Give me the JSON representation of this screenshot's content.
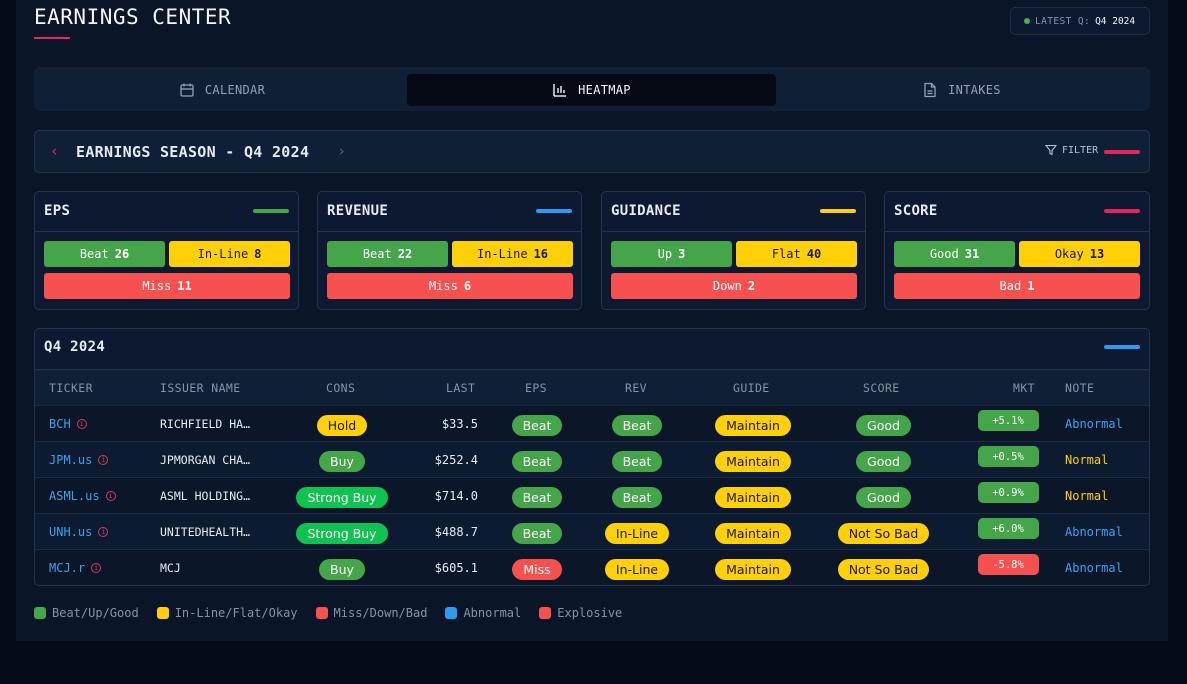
{
  "app": {
    "title": "EARNINGS CENTER",
    "latest_label": "LATEST Q:",
    "latest_value": "Q4 2024"
  },
  "tabs": [
    {
      "label": "CALENDAR",
      "icon": "calendar-icon",
      "active": false
    },
    {
      "label": "HEATMAP",
      "icon": "bar-chart-icon",
      "active": true
    },
    {
      "label": "INTAKES",
      "icon": "document-icon",
      "active": false
    }
  ],
  "season": {
    "title": "EARNINGS SEASON - Q4 2024",
    "prev": "‹",
    "next": "›",
    "filter_label": "FILTER"
  },
  "cards": [
    {
      "title": "EPS",
      "accent": "#44a549",
      "chips": [
        {
          "label": "Beat",
          "value": "26",
          "color": "g"
        },
        {
          "label": "In-Line",
          "value": "8",
          "color": "y"
        },
        {
          "label": "Miss",
          "value": "11",
          "color": "r"
        }
      ]
    },
    {
      "title": "REVENUE",
      "accent": "#2d9bf0",
      "chips": [
        {
          "label": "Beat",
          "value": "22",
          "color": "g"
        },
        {
          "label": "In-Line",
          "value": "16",
          "color": "y"
        },
        {
          "label": "Miss",
          "value": "6",
          "color": "r"
        }
      ]
    },
    {
      "title": "GUIDANCE",
      "accent": "#ffcf07",
      "chips": [
        {
          "label": "Up",
          "value": "3",
          "color": "g"
        },
        {
          "label": "Flat",
          "value": "40",
          "color": "y"
        },
        {
          "label": "Down",
          "value": "2",
          "color": "r"
        }
      ]
    },
    {
      "title": "SCORE",
      "accent": "#e3245d",
      "chips": [
        {
          "label": "Good",
          "value": "31",
          "color": "g"
        },
        {
          "label": "Okay",
          "value": "13",
          "color": "y"
        },
        {
          "label": "Bad",
          "value": "1",
          "color": "r"
        }
      ]
    }
  ],
  "table": {
    "title": "Q4 2024",
    "columns": [
      "TICKER",
      "ISSUER NAME",
      "CONS",
      "LAST",
      "EPS",
      "REV",
      "GUIDE",
      "SCORE",
      "MKT",
      "NOTE"
    ],
    "rows": [
      {
        "ticker": "BCH",
        "issuer": "RICHFIELD HA…",
        "cons": "Hold",
        "cons_color": "y",
        "last": "$33.5",
        "eps": "Beat",
        "eps_color": "g",
        "rev": "Beat",
        "rev_color": "g",
        "guide": "Maintain",
        "guide_color": "y",
        "score": "Good",
        "score_color": "g",
        "mkt": "+5.1%",
        "mkt_color": "g",
        "note": "Abnormal",
        "note_color": "#3b9ff0"
      },
      {
        "ticker": "JPM.us",
        "issuer": "JPMORGAN CHA…",
        "cons": "Buy",
        "cons_color": "g",
        "last": "$252.4",
        "eps": "Beat",
        "eps_color": "g",
        "rev": "Beat",
        "rev_color": "g",
        "guide": "Maintain",
        "guide_color": "y",
        "score": "Good",
        "score_color": "g",
        "mkt": "+0.5%",
        "mkt_color": "g",
        "note": "Normal",
        "note_color": "#ffcf07"
      },
      {
        "ticker": "ASML.us",
        "issuer": "ASML HOLDING…",
        "cons": "Strong Buy",
        "cons_color": "sg",
        "last": "$714.0",
        "eps": "Beat",
        "eps_color": "g",
        "rev": "Beat",
        "rev_color": "g",
        "guide": "Maintain",
        "guide_color": "y",
        "score": "Good",
        "score_color": "g",
        "mkt": "+0.9%",
        "mkt_color": "g",
        "note": "Normal",
        "note_color": "#ffcf07"
      },
      {
        "ticker": "UNH.us",
        "issuer": "UNITEDHEALTH…",
        "cons": "Strong Buy",
        "cons_color": "sg",
        "last": "$488.7",
        "eps": "Beat",
        "eps_color": "g",
        "rev": "In-Line",
        "rev_color": "y",
        "guide": "Maintain",
        "guide_color": "y",
        "score": "Not So Bad",
        "score_color": "y",
        "mkt": "+6.0%",
        "mkt_color": "g",
        "note": "Abnormal",
        "note_color": "#3b9ff0"
      },
      {
        "ticker": "MCJ.r",
        "issuer": "MCJ",
        "cons": "Buy",
        "cons_color": "g",
        "last": "$605.1",
        "eps": "Miss",
        "eps_color": "r",
        "rev": "In-Line",
        "rev_color": "y",
        "guide": "Maintain",
        "guide_color": "y",
        "score": "Not So Bad",
        "score_color": "y",
        "mkt": "-5.8%",
        "mkt_color": "r",
        "note": "Abnormal",
        "note_color": "#3b9ff0"
      }
    ]
  },
  "legend": [
    {
      "label": "Beat/Up/Good",
      "color": "#44a549"
    },
    {
      "label": "In-Line/Flat/Okay",
      "color": "#ffcf07"
    },
    {
      "label": "Miss/Down/Bad",
      "color": "#f6504f"
    },
    {
      "label": "Abnormal",
      "color": "#2d9bf0"
    },
    {
      "label": "Explosive",
      "color": "#f6504f"
    }
  ]
}
